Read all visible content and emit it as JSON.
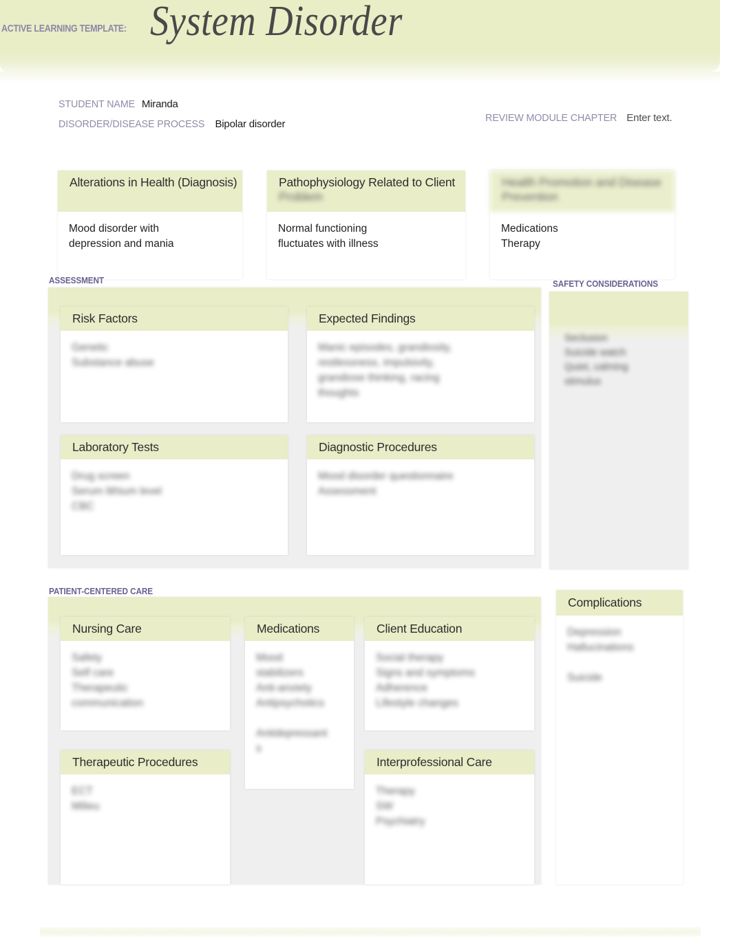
{
  "header": {
    "kicker": "ACTIVE LEARNING TEMPLATE:",
    "title": "System Disorder"
  },
  "form": {
    "student_name_label": "STUDENT NAME",
    "student_name_value": "Miranda",
    "disorder_label": "DISORDER/DISEASE PROCESS",
    "disorder_value": "Bipolar disorder",
    "review_module_label": "REVIEW MODULE CHAPTER",
    "review_module_value": "Enter text."
  },
  "top_boxes": [
    {
      "title": "Alterations in Health (Diagnosis)",
      "body": "Mood disorder with\ndepression and mania",
      "redacted": false
    },
    {
      "title": "Pathophysiology Related to Client\nProblem",
      "body": "Normal functioning\nfluctuates with illness",
      "redacted": false,
      "title_redacted_line": "Problem"
    },
    {
      "title": "Health Promotion and Disease\nPrevention",
      "body": "Medications\nTherapy",
      "redacted": false,
      "title_redacted": true
    }
  ],
  "assessment": {
    "section_label": "ASSESSMENT",
    "boxes": [
      {
        "title": "Risk Factors",
        "body": "Genetic\nSubstance abuse",
        "redacted": true
      },
      {
        "title": "Expected Findings",
        "body": "Manic episodes, grandiosity,\nrestlessness, impulsivity,\ngrandiose thinking, racing\nthoughts",
        "redacted": true
      },
      {
        "title": "Laboratory Tests",
        "body": "Drug screen\nSerum lithium level\nCBC",
        "redacted": true
      },
      {
        "title": "Diagnostic Procedures",
        "body": "Mood disorder questionnaire\nAssessment",
        "redacted": true
      }
    ]
  },
  "safety": {
    "section_label": "SAFETY CONSIDERATIONS",
    "body": "Seclusion\nSuicide watch\nQuiet, calming\nstimulus",
    "redacted": true
  },
  "patient_centered_care": {
    "section_label": "PATIENT-CENTERED CARE",
    "boxes": [
      {
        "title": "Nursing Care",
        "body": "Safety\nSelf care\nTherapeutic\ncommunication",
        "redacted": true
      },
      {
        "title": "Medications",
        "body": "Mood\nstabilizers\nAnti-anxiety\nAntipsychotics\n\nAntidepressant\ns",
        "redacted": true
      },
      {
        "title": "Client Education",
        "body": "Social therapy\nSigns and symptoms\nAdherence\nLifestyle changes",
        "redacted": true
      },
      {
        "title": "Therapeutic Procedures",
        "body": "ECT\nMilieu",
        "redacted": true
      },
      {
        "title": "Interprofessional Care",
        "body": "Therapy\nSW\nPsychiatry",
        "redacted": true
      }
    ]
  },
  "complications": {
    "title": "Complications",
    "body": "Depression\nHallucinations\n\nSuicide",
    "redacted": true
  }
}
